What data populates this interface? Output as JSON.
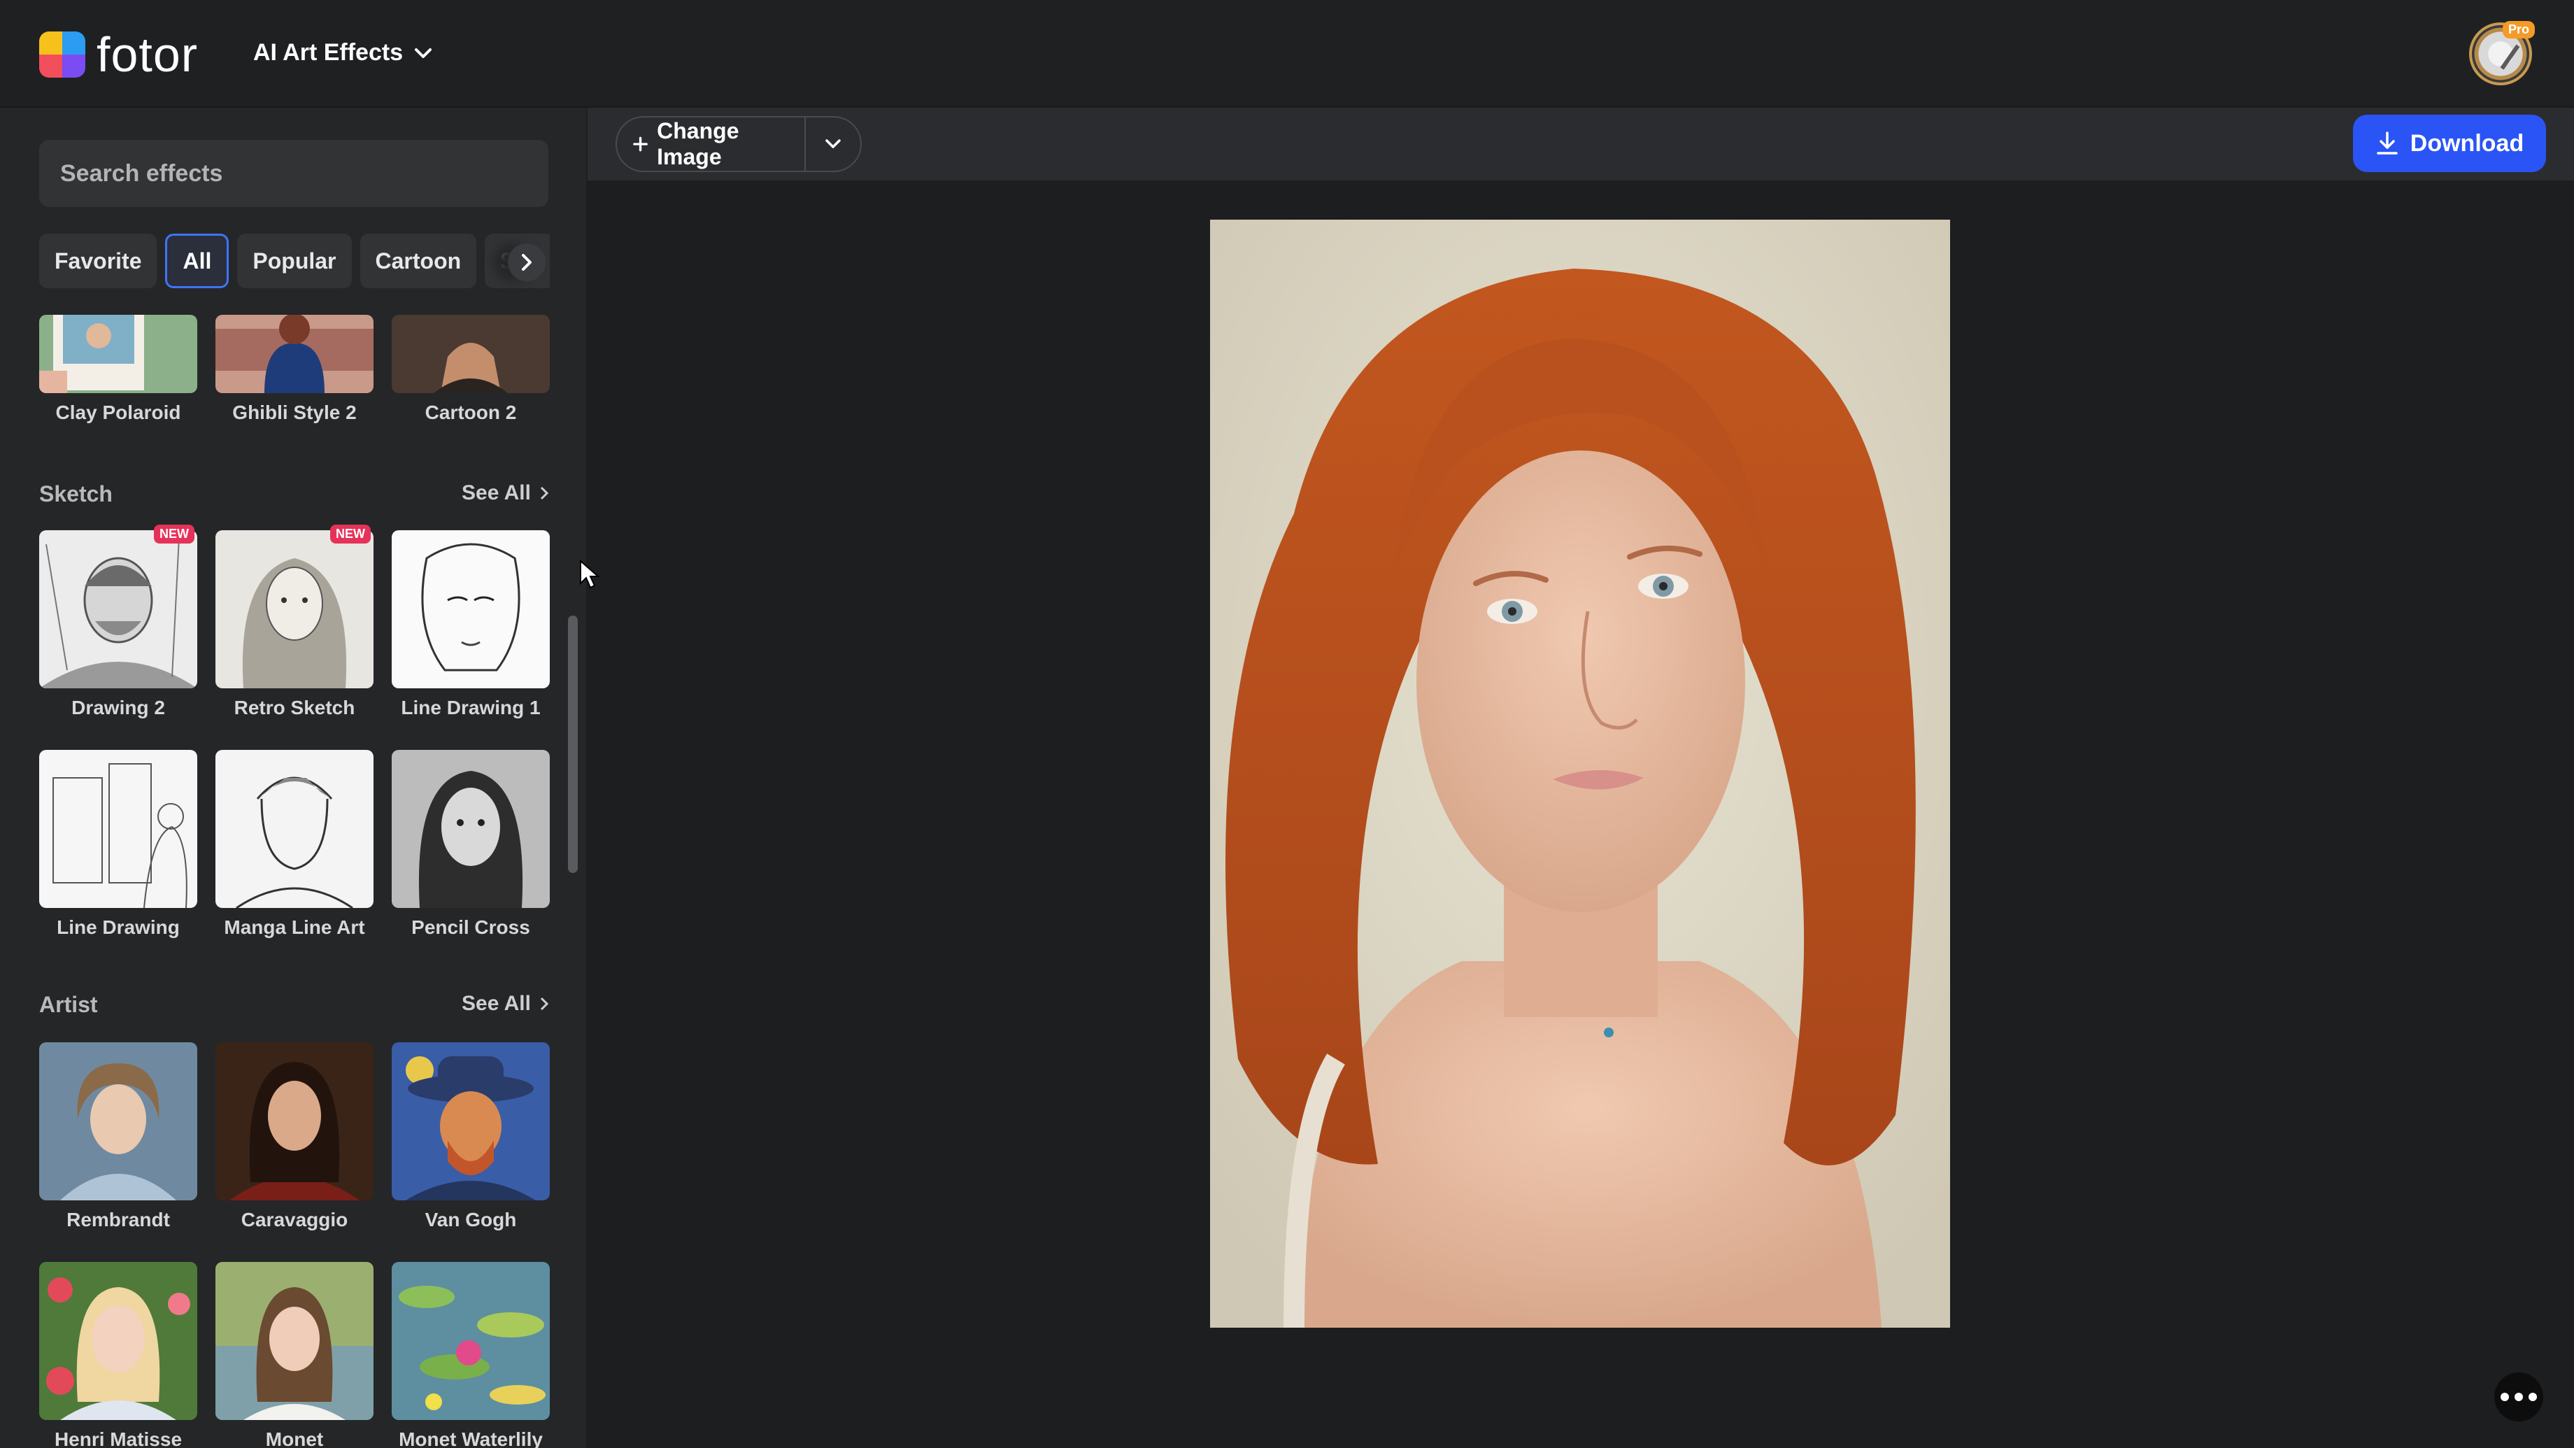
{
  "app": {
    "logo_text": "fotor",
    "menu_title": "AI Art Effects",
    "avatar_badge": "Pro"
  },
  "search": {
    "placeholder": "Search effects"
  },
  "categories": {
    "chips": [
      {
        "label": "Favorite",
        "active": false
      },
      {
        "label": "All",
        "active": true
      },
      {
        "label": "Popular",
        "active": false
      },
      {
        "label": "Cartoon",
        "active": false
      },
      {
        "label": "Ske",
        "active": false
      }
    ]
  },
  "top_row": {
    "items": [
      {
        "label": "Clay Polaroid"
      },
      {
        "label": "Ghibli Style 2"
      },
      {
        "label": "Cartoon 2"
      }
    ]
  },
  "sketch": {
    "title": "Sketch",
    "see_all": "See All",
    "items": [
      {
        "label": "Drawing 2",
        "badge": "NEW"
      },
      {
        "label": "Retro Sketch",
        "badge": "NEW"
      },
      {
        "label": "Line Drawing 1",
        "badge": ""
      },
      {
        "label": "Line Drawing",
        "badge": ""
      },
      {
        "label": "Manga Line Art",
        "badge": ""
      },
      {
        "label": "Pencil Cross",
        "badge": ""
      }
    ]
  },
  "artist": {
    "title": "Artist",
    "see_all": "See All",
    "items": [
      {
        "label": "Rembrandt"
      },
      {
        "label": "Caravaggio"
      },
      {
        "label": "Van Gogh"
      },
      {
        "label": "Henri Matisse"
      },
      {
        "label": "Monet"
      },
      {
        "label": "Monet Waterlily"
      }
    ]
  },
  "toolbar": {
    "change_image": "Change Image",
    "download": "Download"
  },
  "colors": {
    "accent": "#2a54f5",
    "chip_active_border": "#3f74ff",
    "new_badge": "#e5325a",
    "bg_dark": "#1d1e20",
    "sidebar_bg": "#252628"
  }
}
